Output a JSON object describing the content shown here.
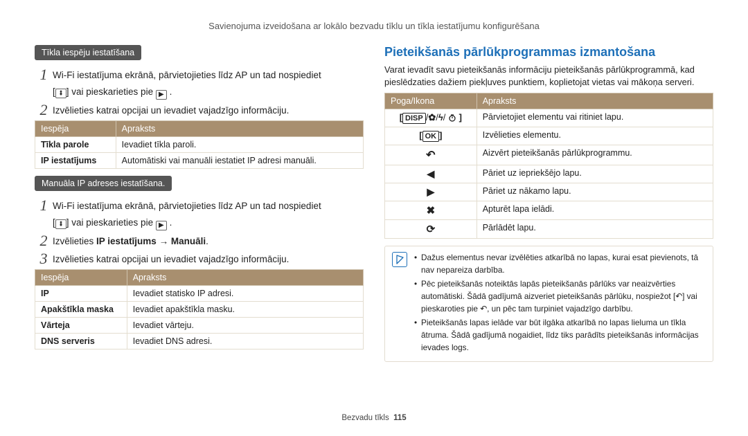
{
  "header": "Savienojuma izveidošana ar lokālo bezvadu tīklu un tīkla iestatījumu konfigurēšana",
  "footer_section": "Bezvadu tīkls",
  "footer_page": "115",
  "left": {
    "pill1": "Tīkla iespēju iestatīšana",
    "step1a": "Wi-Fi iestatījuma ekrānā, pārvietojieties līdz AP un tad nospiediet",
    "step1b_prefix": "[",
    "step1b_mid": "] vai pieskarieties pie ",
    "step2": "Izvēlieties katrai opcijai un ievadiet vajadzīgo informāciju.",
    "t1_h1": "Iespēja",
    "t1_h2": "Apraksts",
    "t1": [
      {
        "k": "Tīkla parole",
        "v": "Ievadiet tīkla paroli."
      },
      {
        "k": "IP iestatījums",
        "v": "Automātiski vai manuāli iestatiet IP adresi manuāli."
      }
    ],
    "pill2": "Manuāla IP adreses iestatīšana.",
    "m_step1a": "Wi-Fi iestatījuma ekrānā, pārvietojieties līdz AP un tad nospiediet",
    "m_step1b_prefix": "[",
    "m_step1b_mid": "] vai pieskarieties pie ",
    "m_step2_pre": "Izvēlieties ",
    "m_step2_bold": "IP iestatījums → Manuāli",
    "m_step2_post": ".",
    "m_step3": "Izvēlieties katrai opcijai un ievadiet vajadzīgo informāciju.",
    "t2_h1": "Iespēja",
    "t2_h2": "Apraksts",
    "t2": [
      {
        "k": "IP",
        "v": "Ievadiet statisko IP adresi."
      },
      {
        "k": "Apakštīkla maska",
        "v": "Ievadiet apakštīkla masku."
      },
      {
        "k": "Vārteja",
        "v": "Ievadiet vārteju."
      },
      {
        "k": "DNS serveris",
        "v": "Ievadiet DNS adresi."
      }
    ]
  },
  "right": {
    "title": "Pieteikšanās pārlūkprogrammas izmantošana",
    "intro": "Varat ievadīt savu pieteikšanās informāciju pieteikšanās pārlūkprogrammā, kad pieslēdzaties dažiem piekļuves punktiem, koplietojat vietas vai mākoņa serveri.",
    "t3_h1": "Poga/Ikona",
    "t3_h2": "Apraksts",
    "t3": [
      {
        "v": "Pārvietojiet elementu vai ritiniet lapu."
      },
      {
        "v": "Izvēlieties elementu."
      },
      {
        "v": "Aizvērt pieteikšanās pārlūkprogrammu."
      },
      {
        "v": "Pāriet uz iepriekšējo lapu."
      },
      {
        "v": "Pāriet uz nākamo lapu."
      },
      {
        "v": "Apturēt lapa ielādi."
      },
      {
        "v": "Pārlādēt lapu."
      }
    ],
    "notes": [
      "Dažus elementus nevar izvēlēties atkarībā no lapas, kurai esat pievienots, tā nav nepareiza darbība.",
      "Pēc pieteikšanās noteiktās lapās pieteikšanās pārlūks var neaizvērties automātiski. Šādā gadījumā aizveriet pieteikšanās pārlūku, nospiežot [↶] vai pieskaroties pie ↶, un pēc tam turpiniet vajadzīgo darbību.",
      "Pieteikšanās lapas ielāde var būt ilgāka atkarībā no lapas lieluma un tīkla ātruma. Šādā gadījumā nogaidiet, līdz tiks parādīts pieteikšanās informācijas ievades logs."
    ]
  }
}
